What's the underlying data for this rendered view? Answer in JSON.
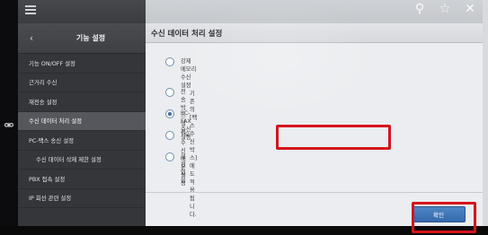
{
  "topbar": {
    "icons": [
      "search-icon",
      "star-icon",
      "close-icon"
    ]
  },
  "sidebar": {
    "title": "기능 설정",
    "items": [
      {
        "label": "기능 ON/OFF 설정",
        "indent": false,
        "active": false
      },
      {
        "label": "근거리 수신",
        "indent": false,
        "active": false
      },
      {
        "label": "재전송 설정",
        "indent": false,
        "active": false
      },
      {
        "label": "수신 데이터 처리 설정",
        "indent": false,
        "active": true
      },
      {
        "label": "PC-팩스 송신 설정",
        "indent": false,
        "active": false
      },
      {
        "label": "수신 데이터 삭제 제한 설정",
        "indent": true,
        "active": false
      },
      {
        "label": "PBX 접속 설정",
        "indent": false,
        "active": false
      },
      {
        "label": "IP 회선 관련 설정",
        "indent": false,
        "active": false
      }
    ]
  },
  "main": {
    "title": "수신 데이터 처리 설정",
    "options": [
      {
        "label": "강제 메모리 수신 설정",
        "sub": "기존의 [팩스 수신 박스]에도 적용됩니다.",
        "checked": false
      },
      {
        "label": "전송 박스 설정",
        "sub": "",
        "checked": false
      },
      {
        "label": "PC-FAX 수신 설정",
        "sub": "",
        "checked": true
      },
      {
        "label": "TSI 수신 배분 설정",
        "sub": "",
        "checked": false
      },
      {
        "label": "설정 없음",
        "sub": "",
        "checked": false
      }
    ],
    "confirm_label": "확인"
  },
  "colors": {
    "highlight": "#d6141c",
    "accent": "#3f6fa8",
    "sidebar_bg": "#34363a"
  }
}
